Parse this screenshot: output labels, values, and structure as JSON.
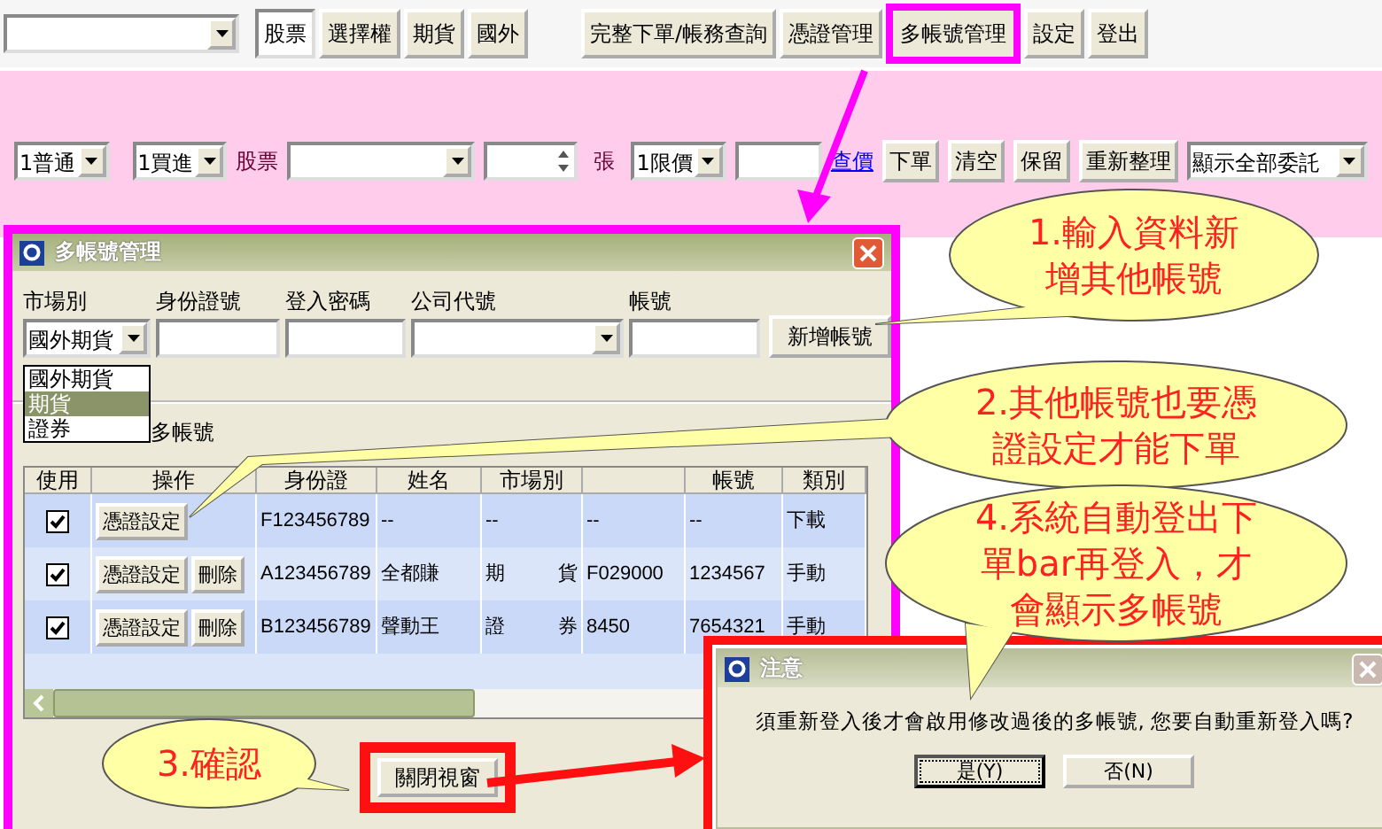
{
  "toolbar": {
    "tabs": [
      {
        "label": "股票",
        "selected": true
      },
      {
        "label": "選擇權",
        "selected": false
      },
      {
        "label": "期貨",
        "selected": false
      },
      {
        "label": "國外",
        "selected": false
      }
    ],
    "buttons": [
      {
        "label": "完整下單/帳務查詢",
        "highlighted": false
      },
      {
        "label": "憑證管理",
        "highlighted": false
      },
      {
        "label": "多帳號管理",
        "highlighted": true
      },
      {
        "label": "設定",
        "highlighted": false
      },
      {
        "label": "登出",
        "highlighted": false
      }
    ]
  },
  "order_bar": {
    "order_type": "1普通",
    "side": "1買進",
    "stock_label": "股票",
    "unit_label": "張",
    "price_type": "1限價",
    "quote_link": "查價",
    "buttons": [
      "下單",
      "清空",
      "保留",
      "重新整理"
    ],
    "filter": "顯示全部委託"
  },
  "account_dialog": {
    "title": "多帳號管理",
    "fields": [
      {
        "label": "市場別",
        "kind": "combo",
        "value": "國外期貨"
      },
      {
        "label": "身份證號",
        "kind": "text"
      },
      {
        "label": "登入密碼",
        "kind": "text"
      },
      {
        "label": "公司代號",
        "kind": "combo"
      },
      {
        "label": "帳號",
        "kind": "text"
      }
    ],
    "add_button": "新增帳號",
    "market_options": [
      {
        "label": "國外期貨",
        "selected": false
      },
      {
        "label": "期貨",
        "selected": true
      },
      {
        "label": "證券",
        "selected": false
      }
    ],
    "section_label": "多帳號",
    "columns": [
      "使用",
      "操作",
      "身份證",
      "姓名",
      "市場別",
      "",
      "帳號",
      "類別"
    ],
    "rows": [
      {
        "cells": [
          {
            "kind": "checkbox",
            "checked": true
          },
          {
            "kind": "buttons",
            "buttons": [
              "憑證設定"
            ]
          },
          {
            "kind": "text",
            "text": "F123456789"
          },
          {
            "kind": "text",
            "text": "--"
          },
          {
            "kind": "text",
            "text": "--"
          },
          {
            "kind": "text",
            "text": "--"
          },
          {
            "kind": "text",
            "text": "--"
          },
          {
            "kind": "text",
            "text": "下載"
          }
        ]
      },
      {
        "cells": [
          {
            "kind": "checkbox",
            "checked": true
          },
          {
            "kind": "buttons",
            "buttons": [
              "憑證設定",
              "刪除"
            ]
          },
          {
            "kind": "text",
            "text": "A123456789"
          },
          {
            "kind": "text",
            "text": "全都賺"
          },
          {
            "kind": "text",
            "text": "期　貨"
          },
          {
            "kind": "text",
            "text": "F029000"
          },
          {
            "kind": "text",
            "text": "1234567"
          },
          {
            "kind": "text",
            "text": "手動"
          }
        ]
      },
      {
        "cells": [
          {
            "kind": "checkbox",
            "checked": true
          },
          {
            "kind": "buttons",
            "buttons": [
              "憑證設定",
              "刪除"
            ]
          },
          {
            "kind": "text",
            "text": "B123456789"
          },
          {
            "kind": "text",
            "text": "聲動王"
          },
          {
            "kind": "text",
            "text": "證　券"
          },
          {
            "kind": "text",
            "text": "8450"
          },
          {
            "kind": "text",
            "text": "7654321"
          },
          {
            "kind": "text",
            "text": "手動"
          }
        ]
      }
    ],
    "close_button": "關閉視窗"
  },
  "alert": {
    "title": "注意",
    "message": "須重新登入後才會啟用修改過後的多帳號, 您要自動重新登入嗎?",
    "buttons": [
      {
        "label": "是(Y)",
        "selected": true
      },
      {
        "label": "否(N)",
        "selected": false
      }
    ]
  },
  "callouts": [
    {
      "text": "1.輸入資料新增其他帳號"
    },
    {
      "text": "2.其他帳號也要憑證設定才能下單"
    },
    {
      "text": "3.確認"
    },
    {
      "text": "4.系統自動登出下單bar再登入，才會顯示多帳號"
    }
  ]
}
